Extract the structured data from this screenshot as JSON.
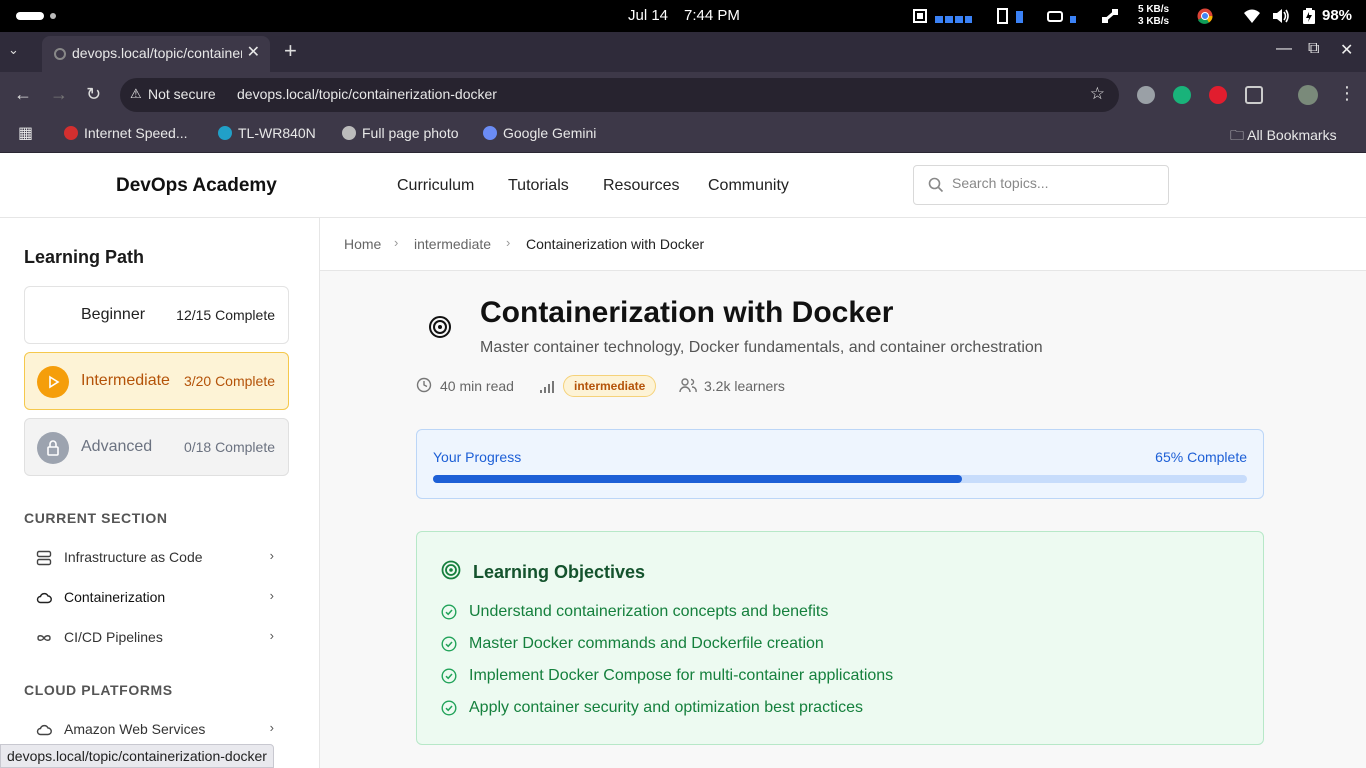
{
  "os": {
    "date": "Jul 14",
    "time": "7:44 PM",
    "net_up": "5 KB/s",
    "net_down": "3 KB/s",
    "battery": "98%"
  },
  "browser": {
    "tab_title": "devops.local/topic/containerization-docker",
    "security_label": "Not secure",
    "url": "devops.local/topic/containerization-docker",
    "bookmarks": [
      "Internet Speed...",
      "TL-WR840N",
      "Full page photo",
      "Google Gemini"
    ],
    "all_bookmarks": "All Bookmarks",
    "status_url": "devops.local/topic/containerization-docker"
  },
  "site": {
    "brand": "DevOps Academy",
    "nav": [
      "Curriculum",
      "Tutorials",
      "Resources",
      "Community"
    ],
    "search_placeholder": "Search topics..."
  },
  "sidebar": {
    "title": "Learning Path",
    "levels": [
      {
        "name": "Beginner",
        "progress": "12/15 Complete"
      },
      {
        "name": "Intermediate",
        "progress": "3/20 Complete"
      },
      {
        "name": "Advanced",
        "progress": "0/18 Complete"
      }
    ],
    "current_section_heading": "CURRENT SECTION",
    "current_section": [
      "Infrastructure as Code",
      "Containerization",
      "CI/CD Pipelines"
    ],
    "cloud_heading": "CLOUD PLATFORMS",
    "cloud": [
      "Amazon Web Services"
    ]
  },
  "breadcrumb": [
    "Home",
    "intermediate",
    "Containerization with Docker"
  ],
  "topic": {
    "title": "Containerization with Docker",
    "subtitle": "Master container technology, Docker fundamentals, and container orchestration",
    "read_time": "40 min read",
    "level_badge": "intermediate",
    "learners": "3.2k learners"
  },
  "progress": {
    "label": "Your Progress",
    "status": "65% Complete",
    "value": 0.65
  },
  "objectives": {
    "title": "Learning Objectives",
    "items": [
      "Understand containerization concepts and benefits",
      "Master Docker commands and Dockerfile creation",
      "Implement Docker Compose for multi-container applications",
      "Apply container security and optimization best practices"
    ]
  },
  "colors": {
    "accent_blue": "#1d5fd6",
    "intermediate_amber": "#f59e0b",
    "objective_green": "#15803d"
  }
}
